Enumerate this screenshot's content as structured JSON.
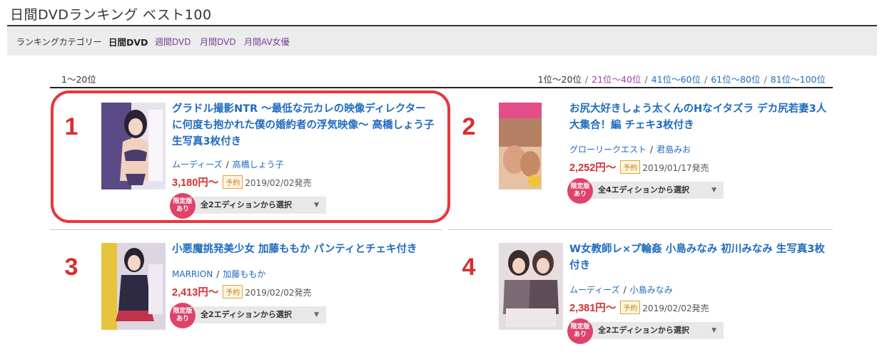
{
  "page": {
    "title": "日間DVDランキング ベスト100"
  },
  "category_bar": {
    "label": "ランキングカテゴリー",
    "current": "日間DVD",
    "links": [
      "週間DVD",
      "月間DVD",
      "月間AV女優"
    ]
  },
  "range_label": "1〜20位",
  "pager": {
    "current": "1位〜20位",
    "links": [
      "21位〜40位",
      "41位〜60位",
      "61位〜80位",
      "81位〜100位"
    ],
    "separator": "/"
  },
  "items": [
    {
      "rank": "1",
      "title": "グラドル撮影NTR 〜最低な元カレの映像ディレクターに何度も抱かれた僕の婚約者の浮気映像〜 高橋しょう子 生写真3枚付き",
      "maker": "ムーディーズ",
      "actress": "高橋しょう子",
      "price": "3,180円〜",
      "reserve_badge": "予約",
      "release": "2019/02/02発売",
      "limited_line1": "限定版",
      "limited_line2": "あり",
      "edition_select": "全2エディションから選択",
      "thumb_color": "#5a4a86"
    },
    {
      "rank": "2",
      "title": "お尻大好きしょう太くんのHなイタズラ デカ尻若妻3人大集合！編 チェキ3枚付き",
      "maker": "グローリークエスト",
      "actress": "君島みお",
      "price": "2,252円〜",
      "reserve_badge": "予約",
      "release": "2019/01/17発売",
      "limited_line1": "限定版",
      "limited_line2": "あり",
      "edition_select": "全4エディションから選択",
      "thumb_color": "#c48a6a"
    },
    {
      "rank": "3",
      "title": "小悪魔挑発美少女 加藤ももか パンティとチェキ付き",
      "maker": "MARRION",
      "actress": "加藤ももか",
      "price": "2,413円〜",
      "reserve_badge": "予約",
      "release": "2019/02/02発売",
      "limited_line1": "限定版",
      "limited_line2": "あり",
      "edition_select": "全2エディションから選択",
      "thumb_color": "#3b3550"
    },
    {
      "rank": "4",
      "title": "W女教師レ×プ輪姦 小島みなみ 初川みなみ 生写真3枚付き",
      "maker": "ムーディーズ",
      "actress": "小島みなみ",
      "price": "2,381円〜",
      "reserve_badge": "予約",
      "release": "2019/02/02発売",
      "limited_line1": "限定版",
      "limited_line2": "あり",
      "edition_select": "全2エディションから選択",
      "thumb_color": "#6a5a60"
    }
  ],
  "colors": {
    "accent_red": "#d43030",
    "link_blue": "#1f6bbf",
    "visited_purple": "#7a3f99",
    "highlight": "#e8363c"
  }
}
